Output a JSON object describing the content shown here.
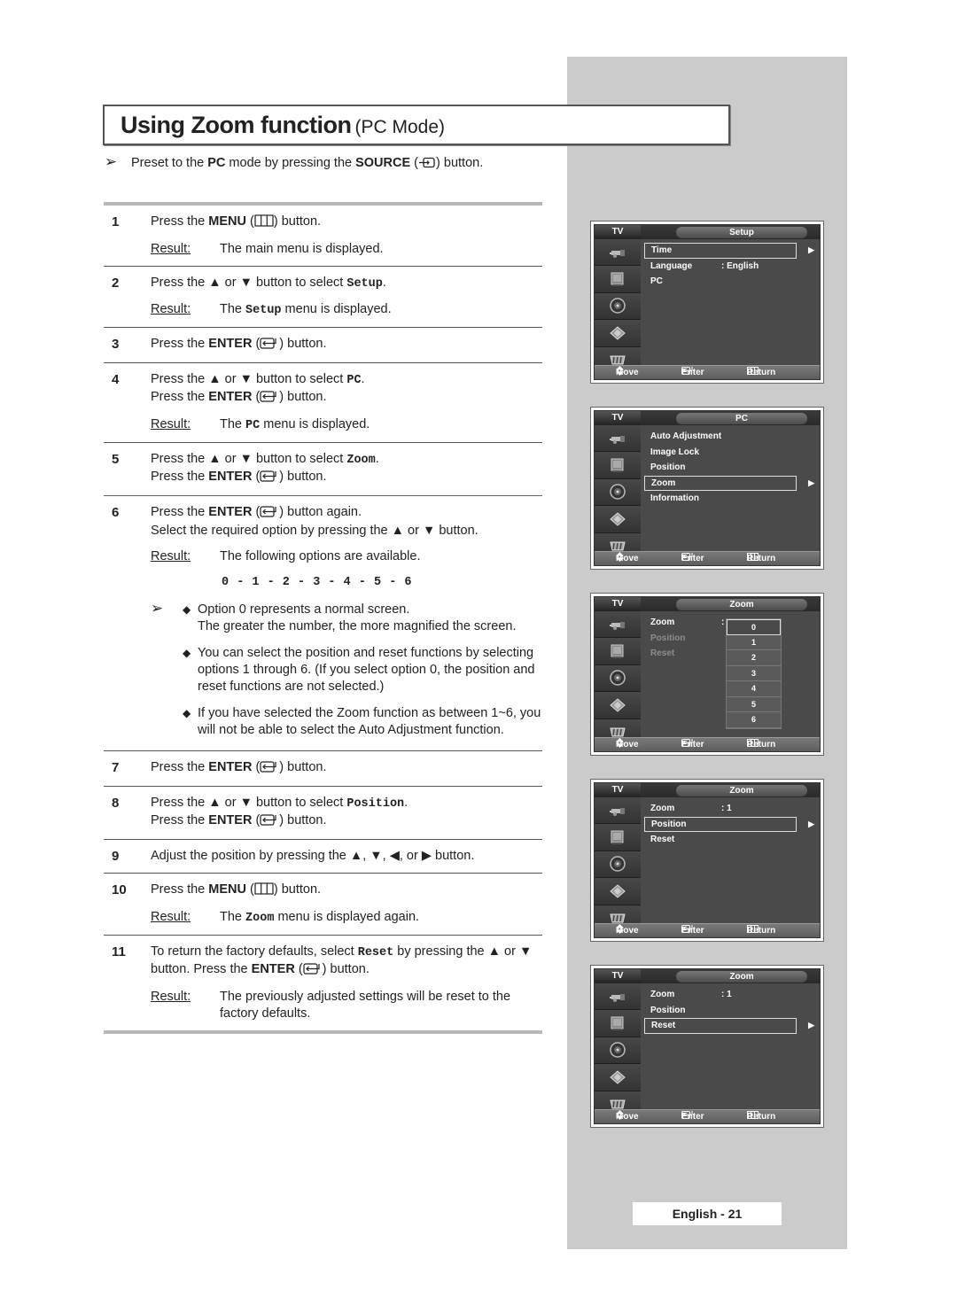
{
  "title": {
    "main": "Using Zoom function",
    "sub": "(PC Mode)"
  },
  "preset": {
    "pre": "Preset to the ",
    "pc": "PC",
    "mid": " mode by pressing the ",
    "source": "SOURCE",
    "post": " button.",
    "icon": "source-icon"
  },
  "common": {
    "press_the": "Press the ",
    "menu": "MENU",
    "enter": "ENTER",
    "button": " button.",
    "button_again": " button again.",
    "up_or_down": " or ",
    "to_select": " button to select ",
    "result_label": "Result:"
  },
  "steps": [
    {
      "num": "1",
      "text": "Press the MENU button.",
      "result": "The main menu is displayed."
    },
    {
      "num": "2",
      "text_pre": "Press the ▲ or ▼ button to select ",
      "code": "Setup",
      "text_post": ".",
      "result_pre": "The ",
      "result_code": "Setup",
      "result_post": " menu is displayed."
    },
    {
      "num": "3",
      "text": "Press the ENTER button."
    },
    {
      "num": "4",
      "text_pre": "Press the ▲ or ▼ button to select ",
      "code": "PC",
      "text_post": ".",
      "line2": "Press the ENTER button.",
      "result_pre": "The ",
      "result_code": "PC",
      "result_post": "  menu is displayed."
    },
    {
      "num": "5",
      "text_pre": "Press the ▲ or ▼ button to select ",
      "code": "Zoom",
      "text_post": ".",
      "line2": "Press the ENTER button."
    },
    {
      "num": "6",
      "text": "Press the ENTER button again.",
      "line2": "Select the required option by pressing the ▲ or ▼ button.",
      "result": "The following options are available.",
      "options": "0 - 1 - 2 - 3  - 4  - 5  - 6",
      "notes": [
        "Option 0 represents a normal screen.\nThe greater the number, the more magnified the screen.",
        "You can select the position and reset functions by selecting options 1 through 6. (If you select option 0, the position and reset functions are not selected.)",
        "If you have selected the Zoom function as between 1~6, you will not be able to select the Auto Adjustment function."
      ]
    },
    {
      "num": "7",
      "text": "Press the ENTER button."
    },
    {
      "num": "8",
      "text_pre": "Press the ▲ or ▼ button to select ",
      "code": "Position",
      "text_post": ".",
      "line2": "Press the ENTER button."
    },
    {
      "num": "9",
      "text": "Adjust the position by pressing the ▲, ▼, ◀, or ▶ button."
    },
    {
      "num": "10",
      "text": "Press the MENU button.",
      "result_pre": "The ",
      "result_code": "Zoom",
      "result_post": "  menu is displayed again."
    },
    {
      "num": "11",
      "text_pre": "To return the factory defaults, select ",
      "code": "Reset",
      "text_post": " by pressing the ▲ or ▼ button. Press the ENTER button.",
      "result": "The previously adjusted settings will be reset to the factory defaults."
    }
  ],
  "osd_common": {
    "tv_label": "TV",
    "footer": {
      "move": "Move",
      "enter": "Enter",
      "return": "Return"
    },
    "sidebar_icons": [
      "input-icon",
      "picture-icon",
      "sound-icon",
      "channel-icon",
      "setup-icon"
    ]
  },
  "osd_screens": [
    {
      "title": "Setup",
      "items": [
        {
          "label": "Time",
          "value": "",
          "selected": true,
          "dim": false,
          "arrow": true
        },
        {
          "label": "Language",
          "value": ": English",
          "selected": false,
          "dim": false,
          "arrow": true
        },
        {
          "label": "PC",
          "value": "",
          "selected": false,
          "dim": false,
          "arrow": true
        }
      ]
    },
    {
      "title": "PC",
      "items": [
        {
          "label": "Auto Adjustment",
          "value": "",
          "selected": false,
          "dim": false,
          "arrow": true
        },
        {
          "label": "Image Lock",
          "value": "",
          "selected": false,
          "dim": false,
          "arrow": true
        },
        {
          "label": "Position",
          "value": "",
          "selected": false,
          "dim": false,
          "arrow": true
        },
        {
          "label": "Zoom",
          "value": "",
          "selected": true,
          "dim": false,
          "arrow": true
        },
        {
          "label": "Information",
          "value": "",
          "selected": false,
          "dim": false,
          "arrow": true
        }
      ]
    },
    {
      "title": "Zoom",
      "items": [
        {
          "label": "Zoom",
          "value": ":",
          "selected": false,
          "dim": false,
          "arrow": false
        },
        {
          "label": "Position",
          "value": "",
          "selected": false,
          "dim": true,
          "arrow": false
        },
        {
          "label": "Reset",
          "value": "",
          "selected": false,
          "dim": true,
          "arrow": false
        }
      ],
      "zoom_options": [
        "0",
        "1",
        "2",
        "3",
        "4",
        "5",
        "6"
      ],
      "zoom_selected": "0"
    },
    {
      "title": "Zoom",
      "items": [
        {
          "label": "Zoom",
          "value": ": 1",
          "selected": false,
          "dim": false,
          "arrow": true
        },
        {
          "label": "Position",
          "value": "",
          "selected": true,
          "dim": false,
          "arrow": true
        },
        {
          "label": "Reset",
          "value": "",
          "selected": false,
          "dim": false,
          "arrow": true
        }
      ]
    },
    {
      "title": "Zoom",
      "items": [
        {
          "label": "Zoom",
          "value": ": 1",
          "selected": false,
          "dim": false,
          "arrow": true
        },
        {
          "label": "Position",
          "value": "",
          "selected": false,
          "dim": false,
          "arrow": true
        },
        {
          "label": "Reset",
          "value": "",
          "selected": true,
          "dim": false,
          "arrow": true
        }
      ]
    }
  ],
  "page_label": "English - 21"
}
